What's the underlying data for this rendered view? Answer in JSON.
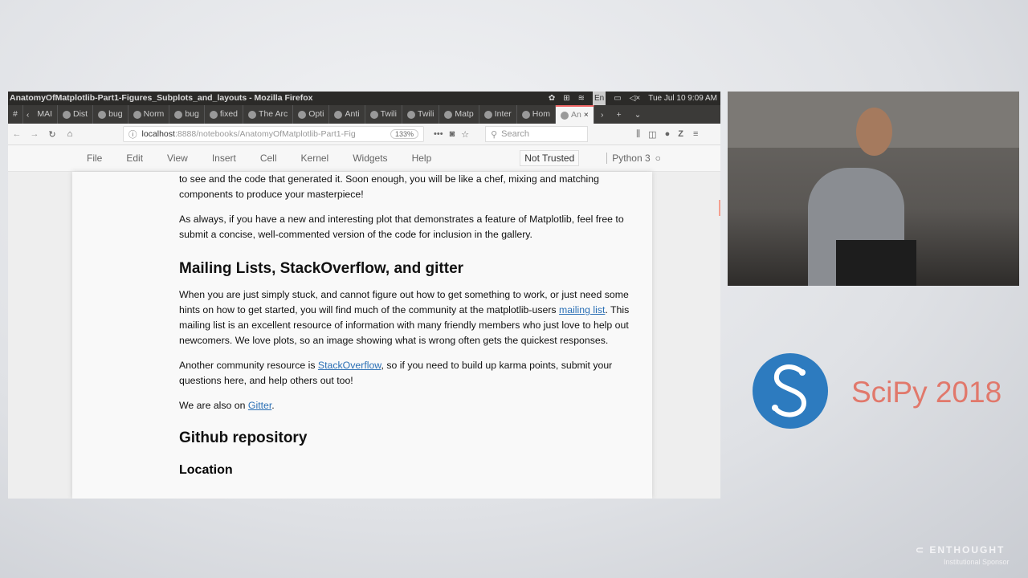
{
  "window": {
    "title": "AnatomyOfMatplotlib-Part1-Figures_Subplots_and_layouts - Mozilla Firefox",
    "system": {
      "lang": "En",
      "clock": "Tue Jul 10  9:09 AM"
    }
  },
  "tabs": [
    "#",
    "MAI",
    "Dist",
    "bug",
    "Norm",
    "bug",
    "fixed",
    "The Arc",
    "Opti",
    "Anti",
    "Twili",
    "Twili",
    "Matp",
    "Inter",
    "Hom",
    "An"
  ],
  "toolbar": {
    "url_host": "localhost",
    "url_rest": ":8888/notebooks/AnatomyOfMatplotlib-Part1-Fig",
    "zoom": "133%",
    "search_placeholder": "Search"
  },
  "menu": {
    "items": [
      "File",
      "Edit",
      "View",
      "Insert",
      "Cell",
      "Kernel",
      "Widgets",
      "Help"
    ],
    "trusted": "Not Trusted",
    "kernel": "Python 3"
  },
  "notebook": {
    "p1": "to see and the code that generated it. Soon enough, you will be like a chef, mixing and matching components to produce your masterpiece!",
    "p2": "As always, if you have a new and interesting plot that demonstrates a feature of Matplotlib, feel free to submit a concise, well-commented version of the code for inclusion in the gallery.",
    "h_mailing": "Mailing Lists, StackOverflow, and gitter",
    "p3a": "When you are just simply stuck, and cannot figure out how to get something to work, or just need some hints on how to get started, you will find much of the community at the matplotlib-users ",
    "p3link": "mailing list",
    "p3b": ". This mailing list is an excellent resource of information with many friendly members who just love to help out newcomers. We love plots, so an image showing what is wrong often gets the quickest responses.",
    "p4a": "Another community resource is ",
    "p4link": "StackOverflow",
    "p4b": ", so if you need to build up karma points, submit your questions here, and help others out too!",
    "p5a": "We are also on ",
    "p5link": "Gitter",
    "p5b": ".",
    "h_github": "Github repository",
    "h_location": "Location"
  },
  "branding": {
    "conference": "SciPy 2018",
    "sponsor": "ENTHOUGHT",
    "sponsor_sub": "Institutional Sponsor",
    "accent": "#e1786b",
    "logo_color": "#2d7bbf"
  }
}
